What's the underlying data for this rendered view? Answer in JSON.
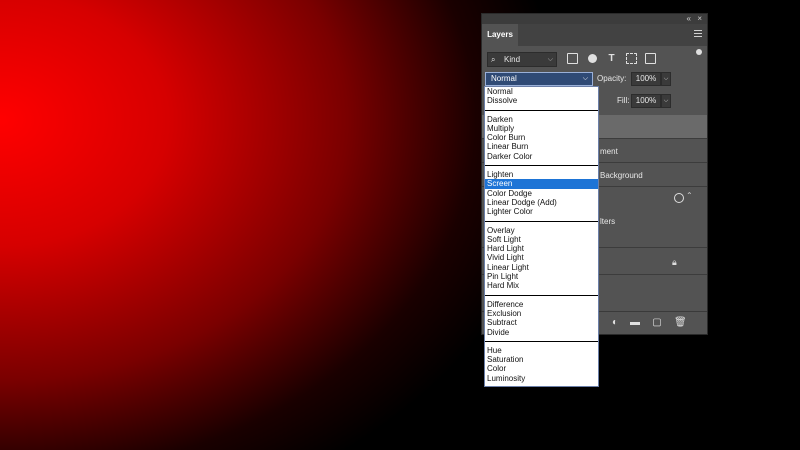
{
  "panel": {
    "tab_label": "Layers",
    "kind_label": "Kind",
    "blend_mode": "Normal",
    "opacity_label": "Opacity:",
    "opacity_value": "100%",
    "fill_label": "Fill:",
    "fill_value": "100%",
    "layer_fragments": [
      "ment",
      "Background",
      "lters"
    ]
  },
  "dropdown": {
    "groups": [
      [
        "Normal",
        "Dissolve"
      ],
      [
        "Darken",
        "Multiply",
        "Color Burn",
        "Linear Burn",
        "Darker Color"
      ],
      [
        "Lighten",
        "Screen",
        "Color Dodge",
        "Linear Dodge (Add)",
        "Lighter Color"
      ],
      [
        "Overlay",
        "Soft Light",
        "Hard Light",
        "Vivid Light",
        "Linear Light",
        "Pin Light",
        "Hard Mix"
      ],
      [
        "Difference",
        "Exclusion",
        "Subtract",
        "Divide"
      ],
      [
        "Hue",
        "Saturation",
        "Color",
        "Luminosity"
      ]
    ],
    "highlighted": "Screen"
  },
  "colors": {
    "highlight": "#1d74d6",
    "canvas_red": "#ff0000"
  },
  "icons": [
    "collapse-icon",
    "close-icon",
    "panel-menu-icon",
    "search-icon",
    "image-filter-icon",
    "adjustment-filter-icon",
    "type-filter-icon",
    "shape-filter-icon",
    "smart-object-filter-icon",
    "filter-toggle-icon",
    "lock-icon",
    "adjustment-layer-icon",
    "group-folder-icon",
    "new-layer-icon",
    "trash-icon"
  ]
}
